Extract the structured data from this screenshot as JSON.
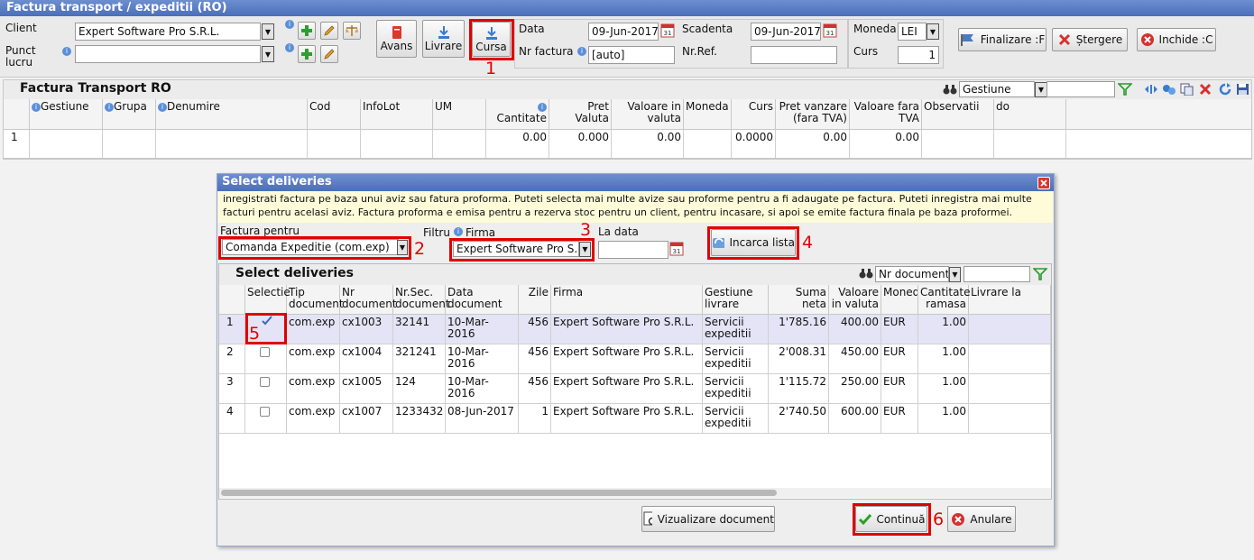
{
  "window": {
    "title": "Factura transport / expeditii (RO)"
  },
  "header": {
    "client_label": "Client",
    "client_value": "Expert Software Pro S.R.L.",
    "punct_label_1": "Punct",
    "punct_label_2": "lucru",
    "punct_value": "",
    "avans_label": "Avans",
    "livrare_label": "Livrare",
    "cursa_label": "Cursa",
    "data_label": "Data",
    "data_value": "09-Jun-2017",
    "nrfactura_label": "Nr factura",
    "nrfactura_value": "[auto]",
    "scadenta_label": "Scadenta",
    "scadenta_value": "09-Jun-2017",
    "nrref_label": "Nr.Ref.",
    "nrref_value": "",
    "moneda_label": "Moneda",
    "moneda_value": "LEI",
    "curs_label": "Curs",
    "curs_value": "1",
    "finalizare_label": "Finalizare :F",
    "stergere_label": "Ștergere",
    "inchide_label": "Inchide :C"
  },
  "main_grid": {
    "title": "Factura Transport RO",
    "search_field": "Gestiune",
    "columns": [
      "Gestiune",
      "Grupa",
      "Denumire",
      "Cod",
      "InfoLot",
      "UM",
      "Cantitate",
      "Pret Valuta",
      "Valoare in valuta",
      "Moneda",
      "Curs",
      "Pret vanzare (fara TVA)",
      "Valoare fara TVA",
      "Observatii",
      "do"
    ],
    "row": {
      "num": "1",
      "cantitate": "0.00",
      "pret_valuta": "0.000",
      "valoare_valuta": "0.00",
      "curs": "0.0000",
      "pret_vanzare": "0.00",
      "valoare_fara_tva": "0.00"
    }
  },
  "dialog": {
    "title": "Select deliveries",
    "info_text": "inregistrati factura pe baza unui aviz sau fatura proforma. Puteti selecta mai multe avize sau proforme pentru a fi adaugate pe factura. Puteti inregistra mai multe facturi pentru acelasi aviz. Factura proforma e emisa pentru a rezerva stoc pentru un client, pentru incasare, si apoi se emite factura finala pe baza proformei.",
    "factura_pentru_label": "Factura pentru",
    "factura_pentru_value": "Comanda Expeditie (com.exp)",
    "filtru_label": "Filtru",
    "firma_label": "Firma",
    "firma_value": "Expert Software Pro S.R.L.",
    "la_data_label": "La data",
    "la_data_value": "",
    "incarca_label": "Incarca lista",
    "grid_title": "Select deliveries",
    "grid_search": "Nr document",
    "columns": [
      "Selectie",
      "Tip document",
      "Nr document",
      "Nr.Sec. document",
      "Data document",
      "Zile",
      "Firma",
      "Gestiune livrare",
      "Suma neta",
      "Valoare in valuta",
      "Moneda",
      "Cantitate ramasa",
      "Livrare la"
    ],
    "rows": [
      {
        "num": "1",
        "checked": true,
        "tip": "com.exp",
        "nr": "cx1003",
        "nrsec": "32141",
        "data": "10-Mar-2016",
        "zile": "456",
        "firma": "Expert Software Pro S.R.L.",
        "gest1": "Servicii",
        "gest2": "expeditii",
        "suma": "1'785.16",
        "valoare": "400.00",
        "moneda": "EUR",
        "cant": "1.00",
        "livrare": ""
      },
      {
        "num": "2",
        "checked": false,
        "tip": "com.exp",
        "nr": "cx1004",
        "nrsec": "321241",
        "data": "10-Mar-2016",
        "zile": "456",
        "firma": "Expert Software Pro S.R.L.",
        "gest1": "Servicii",
        "gest2": "expeditii",
        "suma": "2'008.31",
        "valoare": "450.00",
        "moneda": "EUR",
        "cant": "1.00",
        "livrare": ""
      },
      {
        "num": "3",
        "checked": false,
        "tip": "com.exp",
        "nr": "cx1005",
        "nrsec": "124",
        "data": "10-Mar-2016",
        "zile": "456",
        "firma": "Expert Software Pro S.R.L.",
        "gest1": "Servicii",
        "gest2": "expeditii",
        "suma": "1'115.72",
        "valoare": "250.00",
        "moneda": "EUR",
        "cant": "1.00",
        "livrare": ""
      },
      {
        "num": "4",
        "checked": false,
        "tip": "com.exp",
        "nr": "cx1007",
        "nrsec": "1233432",
        "data": "08-Jun-2017",
        "zile": "1",
        "firma": "Expert Software Pro S.R.L.",
        "gest1": "Servicii",
        "gest2": "expeditii",
        "suma": "2'740.50",
        "valoare": "600.00",
        "moneda": "EUR",
        "cant": "1.00",
        "livrare": ""
      }
    ],
    "vizualizare_label": "Vizualizare document",
    "continua_label": "Continuă",
    "anulare_label": "Anulare"
  },
  "annotations": [
    "1",
    "2",
    "3",
    "4",
    "5",
    "6"
  ],
  "colors": {
    "title_blue": "#4a6fb9",
    "highlight_red": "#e00000",
    "selected_row": "#e4e4f6",
    "info_yellow": "#fefbd8"
  }
}
